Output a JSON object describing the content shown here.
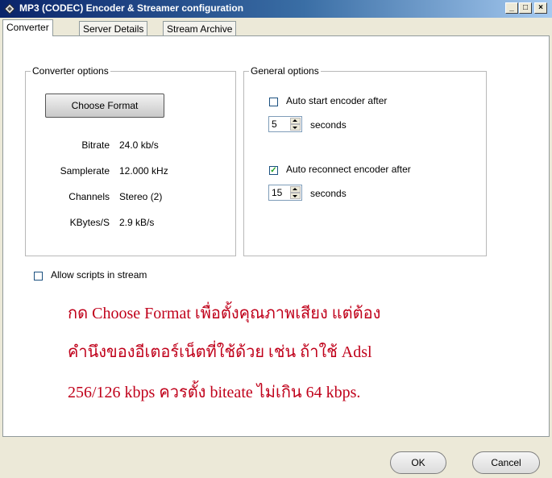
{
  "window": {
    "title": "MP3 (CODEC) Encoder & Streamer configuration",
    "minimize_glyph": "_",
    "maximize_glyph": "□",
    "close_glyph": "×"
  },
  "tabs": [
    {
      "label": "Converter",
      "active": true
    },
    {
      "label": "Server Details",
      "active": false
    },
    {
      "label": "Stream Archive",
      "active": false
    }
  ],
  "converter_options": {
    "group_label": "Converter options",
    "choose_format_label": "Choose Format",
    "rows": [
      {
        "label": "Bitrate",
        "value": "24.0 kb/s"
      },
      {
        "label": "Samplerate",
        "value": "12.000 kHz"
      },
      {
        "label": "Channels",
        "value": "Stereo (2)"
      },
      {
        "label": "KBytes/S",
        "value": "2.9 kB/s"
      }
    ]
  },
  "general_options": {
    "group_label": "General options",
    "auto_start": {
      "label": "Auto start encoder after",
      "checked": false,
      "value": "5",
      "unit": "seconds"
    },
    "auto_reconnect": {
      "label": "Auto reconnect encoder after",
      "checked": true,
      "value": "15",
      "unit": "seconds"
    }
  },
  "allow_scripts": {
    "label": "Allow scripts in stream",
    "checked": false
  },
  "note_lines": [
    "กด Choose Format เพื่อตั้งคุณภาพเสียง แต่ต้อง",
    "คำนึงของอีเตอร์เน็ตที่ใช้ด้วย เช่น ถ้าใช้ Adsl",
    "256/126 kbps ควรตั้ง biteate ไม่เกิน 64 kbps."
  ],
  "buttons": {
    "ok": "OK",
    "cancel": "Cancel"
  },
  "colors": {
    "note": "#c0001a",
    "check": "#21a121"
  }
}
